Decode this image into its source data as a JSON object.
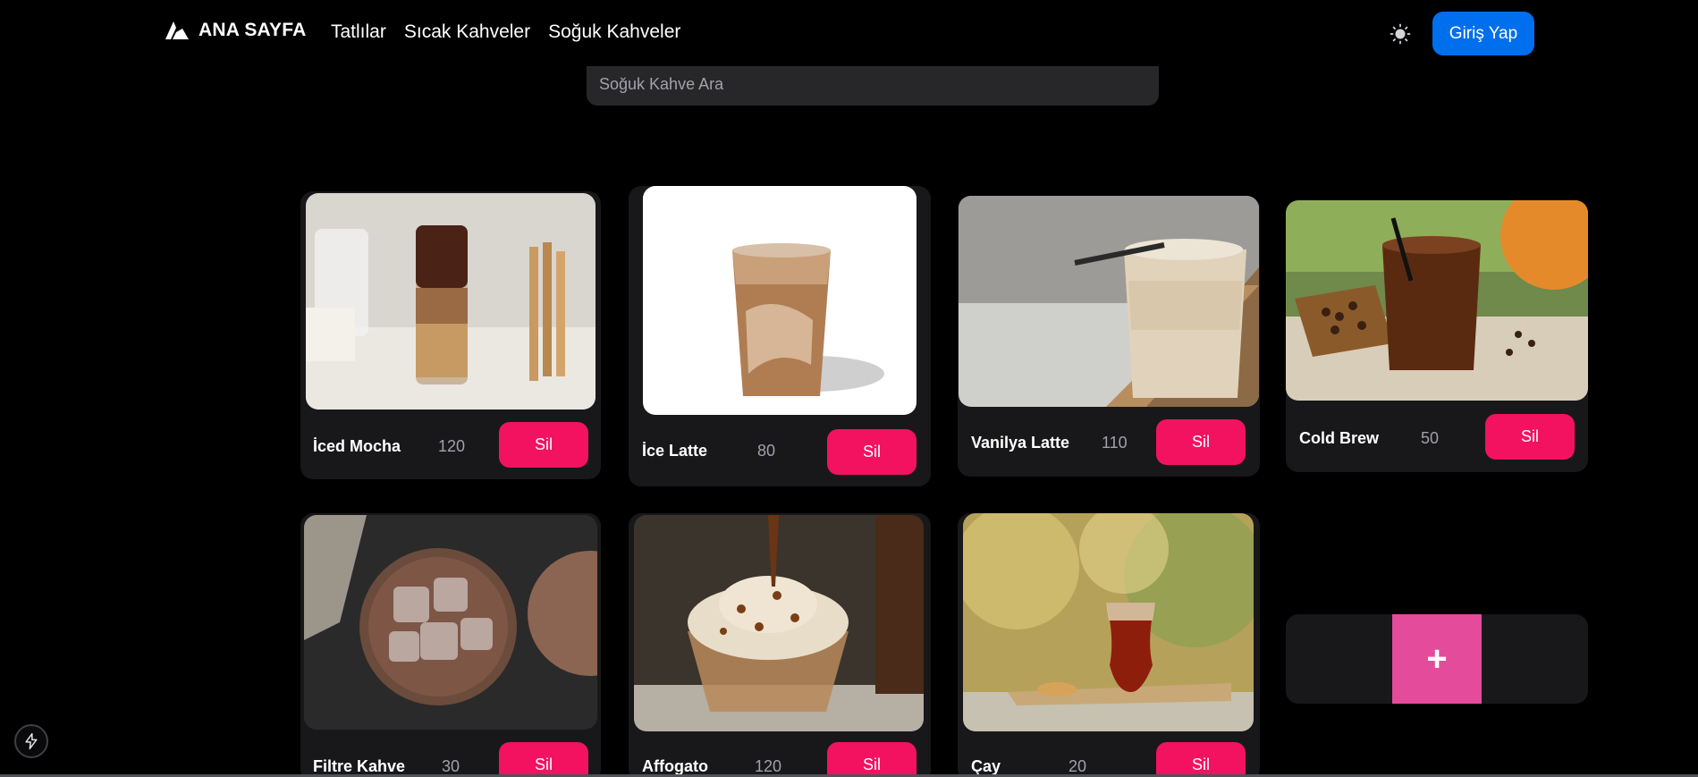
{
  "nav": {
    "brand": "ANA SAYFA",
    "links": [
      "Tatlılar",
      "Sıcak Kahveler",
      "Soğuk Kahveler"
    ],
    "login_label": "Giriş Yap"
  },
  "search": {
    "placeholder": "Soğuk Kahve Ara",
    "value": ""
  },
  "products": [
    {
      "name": "İced Mocha",
      "price": "120",
      "delete_label": "Sil"
    },
    {
      "name": "İce Latte",
      "price": "80",
      "delete_label": "Sil"
    },
    {
      "name": "Vanilya Latte",
      "price": "110",
      "delete_label": "Sil"
    },
    {
      "name": "Cold Brew",
      "price": "50",
      "delete_label": "Sil"
    },
    {
      "name": "Filtre Kahve",
      "price": "30",
      "delete_label": "Sil"
    },
    {
      "name": "Affogato",
      "price": "120",
      "delete_label": "Sil"
    },
    {
      "name": "Çay",
      "price": "20",
      "delete_label": "Sil"
    }
  ],
  "add_button": "+",
  "colors": {
    "primary": "#006fee",
    "danger": "#f31260",
    "add": "#e54b9b",
    "card": "#18181b",
    "input": "#27272a"
  },
  "icons": {
    "brand": "brand-logo-icon",
    "theme": "sun-icon",
    "dev": "lightning-icon"
  }
}
